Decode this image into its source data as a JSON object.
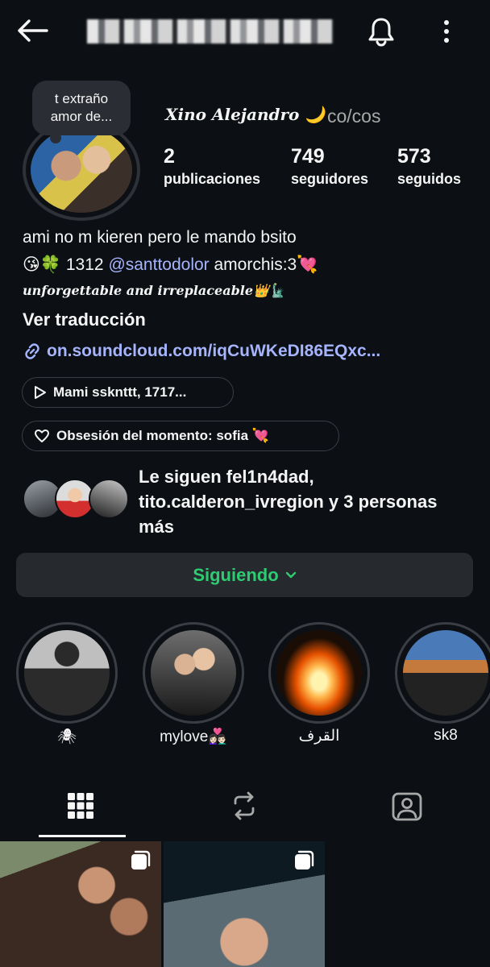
{
  "header": {
    "back_icon": "arrow-left-icon",
    "notifications_icon": "bell-icon",
    "more_icon": "more-vertical-icon"
  },
  "profile": {
    "note": "t extraño amor de...",
    "display_name": "Xino Alejandro 🌙",
    "pronouns": "co/cos",
    "stats": {
      "posts_count": "2",
      "posts_label": "publicaciones",
      "followers_count": "749",
      "followers_label": "seguidores",
      "following_count": "573",
      "following_label": "seguidos"
    },
    "bio": {
      "line1": "ami no m kieren pero le mando bsito",
      "line2_prefix": "😘🍀 1312 ",
      "mention": "@santtodolor",
      "line2_suffix": " amorchis:3💘",
      "line3": "unforgettable and irreplaceable👑🗽",
      "translate": "Ver traducción",
      "link": "on.soundcloud.com/iqCuWKeDI86EQxc..."
    },
    "music_pill": "Mami  ssknttt, 1717...",
    "obsession_pill": "Obsesión del momento:  sofia 💘",
    "followed_by": "Le siguen fel1n4dad, tito.calderon_ivregion y 3 personas más",
    "follow_button": "Siguiendo"
  },
  "highlights": [
    {
      "label": "🕷"
    },
    {
      "label": "mylove👩🏻‍❤️‍👨🏻"
    },
    {
      "label": "القرف"
    },
    {
      "label": "sk8"
    }
  ],
  "tabs": [
    "grid-icon",
    "reels-repost-icon",
    "tagged-icon"
  ],
  "colors": {
    "background": "#0c1014",
    "link": "#a5b4fc",
    "following_green": "#2ecc71",
    "button_bg": "#262a2f"
  }
}
